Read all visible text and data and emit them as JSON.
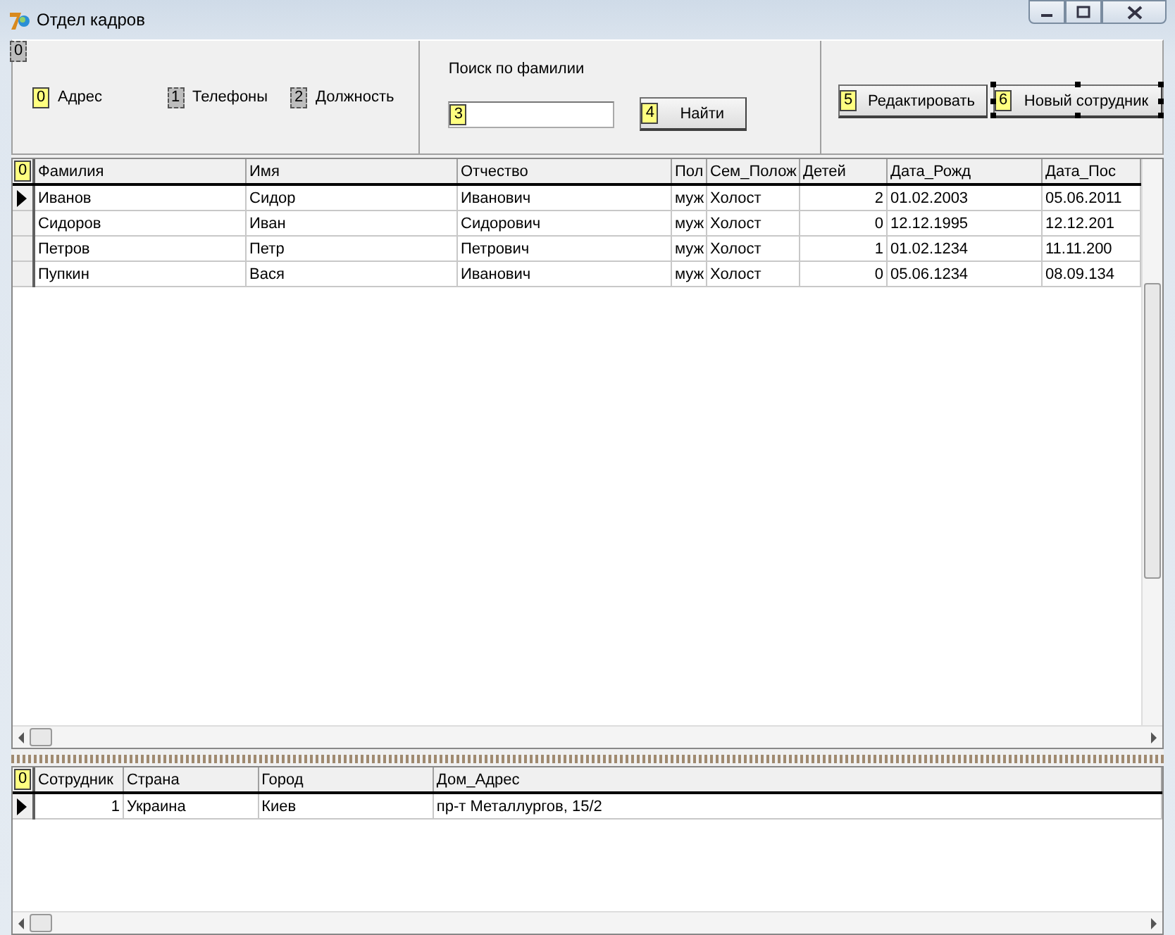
{
  "window": {
    "title": "Отдел кадров"
  },
  "top_panel": {
    "tab_order": "0",
    "tab_order_highlighted": false,
    "labels": [
      {
        "order": "0",
        "highlighted": true,
        "text": "Адрес"
      },
      {
        "order": "1",
        "highlighted": false,
        "text": "Телефоны"
      },
      {
        "order": "2",
        "highlighted": false,
        "text": "Должность"
      }
    ],
    "search": {
      "caption": "Поиск по фамилии",
      "field_order": "3",
      "button": {
        "order": "4",
        "label": "Найти",
        "selected": false
      }
    },
    "buttons": [
      {
        "order": "5",
        "label": "Редактировать",
        "selected": false
      },
      {
        "order": "6",
        "label": "Новый сотрудник",
        "selected": true
      }
    ]
  },
  "employees_grid": {
    "tab_order": "0",
    "columns": [
      {
        "title": "Фамилия",
        "kind": "text"
      },
      {
        "title": "Имя",
        "kind": "text"
      },
      {
        "title": "Отчество",
        "kind": "text"
      },
      {
        "title": "Пол",
        "kind": "text"
      },
      {
        "title": "Сем_Полож",
        "kind": "text"
      },
      {
        "title": "Детей",
        "kind": "number"
      },
      {
        "title": "Дата_Рожд",
        "kind": "text"
      },
      {
        "title": "Дата_Пос",
        "kind": "text"
      }
    ],
    "rows": [
      {
        "current": true,
        "cells": [
          "Иванов",
          "Сидор",
          "Иванович",
          "муж",
          "Холост",
          "2",
          "01.02.2003",
          "05.06.2011"
        ]
      },
      {
        "current": false,
        "cells": [
          "Сидоров",
          "Иван",
          "Сидорович",
          "муж",
          "Холост",
          "0",
          "12.12.1995",
          "12.12.201"
        ]
      },
      {
        "current": false,
        "cells": [
          "Петров",
          "Петр",
          "Петрович",
          "муж",
          "Холост",
          "1",
          "01.02.1234",
          "11.11.200"
        ]
      },
      {
        "current": false,
        "cells": [
          "Пупкин",
          "Вася",
          "Иванович",
          "муж",
          "Холост",
          "0",
          "05.06.1234",
          "08.09.134"
        ]
      }
    ]
  },
  "address_grid": {
    "tab_order": "0",
    "columns": [
      {
        "title": "Сотрудник",
        "kind": "number"
      },
      {
        "title": "Страна",
        "kind": "text"
      },
      {
        "title": "Город",
        "kind": "text"
      },
      {
        "title": "Дом_Адрес",
        "kind": "text"
      }
    ],
    "rows": [
      {
        "current": true,
        "cells": [
          "1",
          "Украина",
          "Киев",
          "пр-т Металлургов, 15/2"
        ]
      }
    ]
  }
}
